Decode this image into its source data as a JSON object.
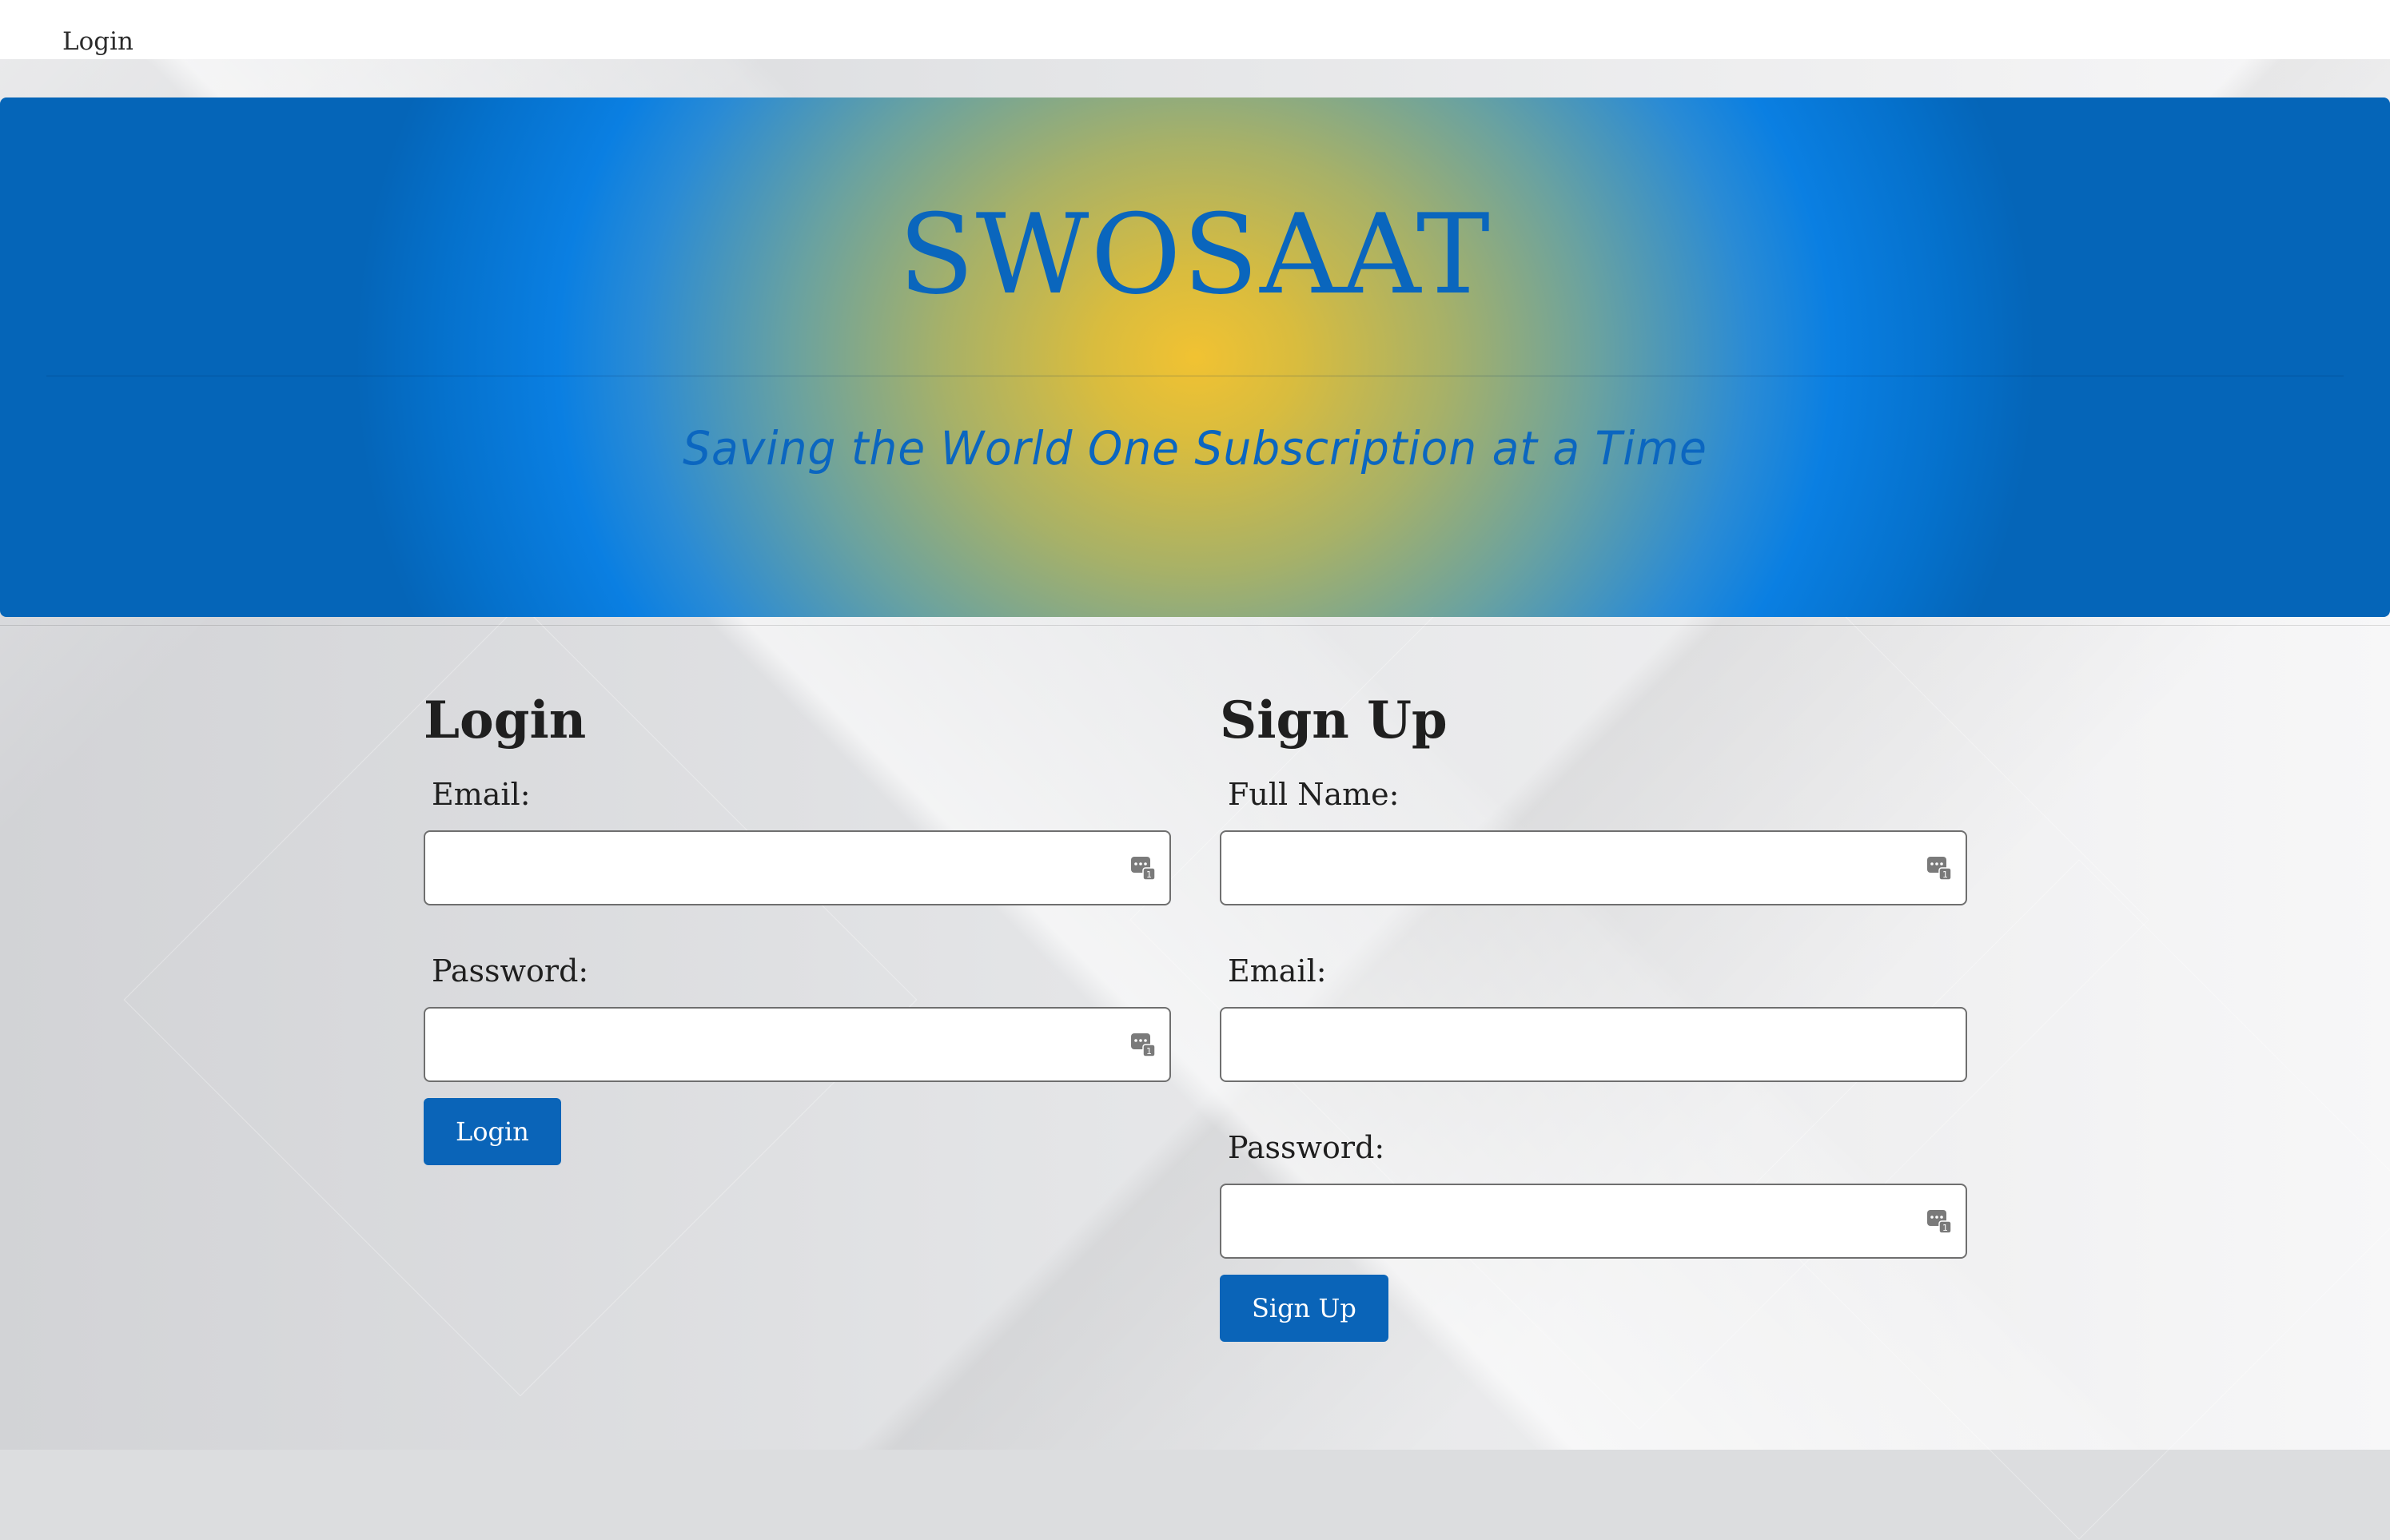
{
  "nav": {
    "login_link": "Login"
  },
  "hero": {
    "title": "SWOSAAT",
    "subtitle": "Saving the World One Subscription at a Time"
  },
  "login": {
    "heading": "Login",
    "email_label": "Email:",
    "password_label": "Password:",
    "email_value": "",
    "password_value": "",
    "submit_label": "Login"
  },
  "signup": {
    "heading": "Sign Up",
    "name_label": "Full Name:",
    "email_label": "Email:",
    "password_label": "Password:",
    "name_value": "",
    "email_value": "",
    "password_value": "",
    "submit_label": "Sign Up"
  },
  "icons": {
    "password_manager": "password-manager-icon"
  },
  "colors": {
    "primary_button": "#0a64b8",
    "hero_blue": "#0a7fe2",
    "hero_gold": "#f1c232",
    "title_blue": "#0a66bd"
  }
}
